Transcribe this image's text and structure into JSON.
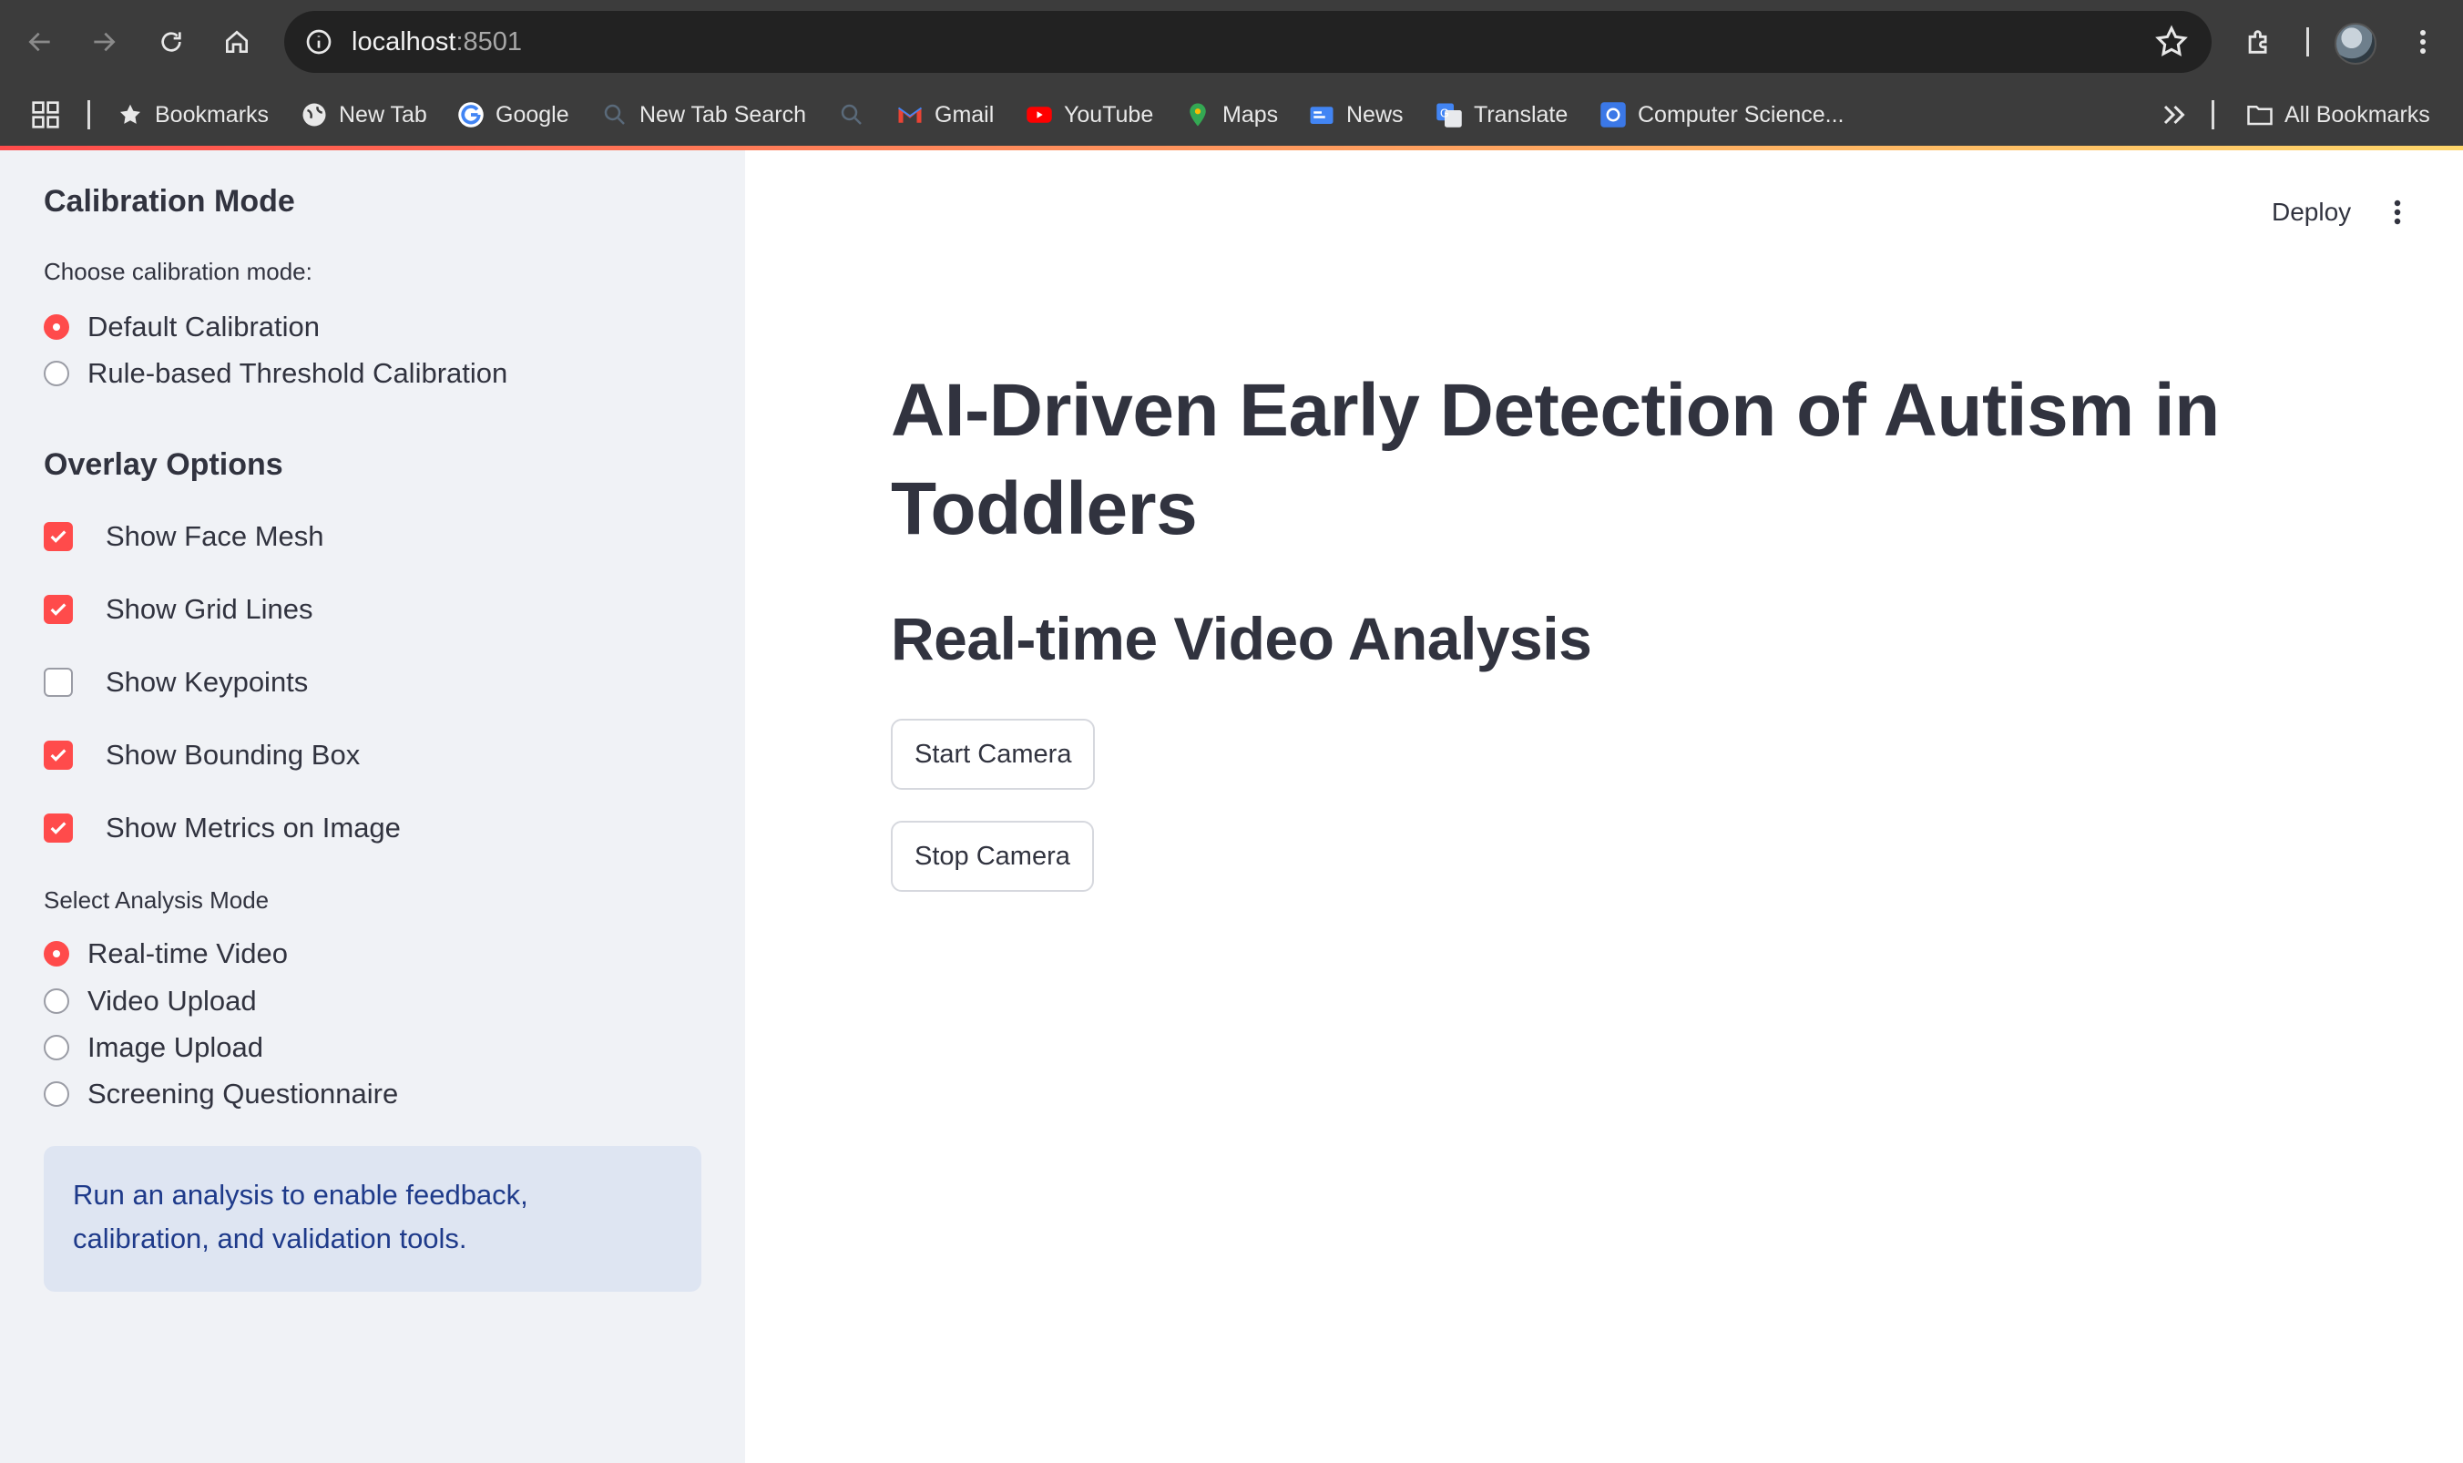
{
  "browser": {
    "url_host": "localhost",
    "url_port": ":8501",
    "bookmarks": [
      {
        "label": "Bookmarks",
        "icon": "star-icon"
      },
      {
        "label": "New Tab",
        "icon": "globe-icon"
      },
      {
        "label": "Google",
        "icon": "google-icon"
      },
      {
        "label": "New Tab Search",
        "icon": "search-icon"
      },
      {
        "label": "",
        "icon": "search-icon"
      },
      {
        "label": "Gmail",
        "icon": "gmail-icon"
      },
      {
        "label": "YouTube",
        "icon": "youtube-icon"
      },
      {
        "label": "Maps",
        "icon": "maps-icon"
      },
      {
        "label": "News",
        "icon": "news-icon"
      },
      {
        "label": "Translate",
        "icon": "translate-icon"
      },
      {
        "label": "Computer Science...",
        "icon": "computer-science-icon"
      }
    ],
    "all_bookmarks": "All Bookmarks"
  },
  "sidebar": {
    "calibration_header": "Calibration Mode",
    "calibration_label": "Choose calibration mode:",
    "calibration_options": [
      {
        "label": "Default Calibration",
        "selected": true
      },
      {
        "label": "Rule-based Threshold Calibration",
        "selected": false
      }
    ],
    "overlay_header": "Overlay Options",
    "overlay_options": [
      {
        "label": "Show Face Mesh",
        "checked": true
      },
      {
        "label": "Show Grid Lines",
        "checked": true
      },
      {
        "label": "Show Keypoints",
        "checked": false
      },
      {
        "label": "Show Bounding Box",
        "checked": true
      },
      {
        "label": "Show Metrics on Image",
        "checked": true
      }
    ],
    "analysis_label": "Select Analysis Mode",
    "analysis_options": [
      {
        "label": "Real-time Video",
        "selected": true
      },
      {
        "label": "Video Upload",
        "selected": false
      },
      {
        "label": "Image Upload",
        "selected": false
      },
      {
        "label": "Screening Questionnaire",
        "selected": false
      }
    ],
    "info": "Run an analysis to enable feedback, calibration, and validation tools."
  },
  "main": {
    "deploy_label": "Deploy",
    "title": "AI-Driven Early Detection of Autism in Toddlers",
    "subtitle": "Real-time Video Analysis",
    "start_button": "Start Camera",
    "stop_button": "Stop Camera"
  },
  "colors": {
    "accent": "#ff4b4b",
    "sidebar_bg": "#f0f2f6",
    "text": "#31333f",
    "info_bg": "#dee5f2",
    "info_text": "#1e3a8a"
  }
}
